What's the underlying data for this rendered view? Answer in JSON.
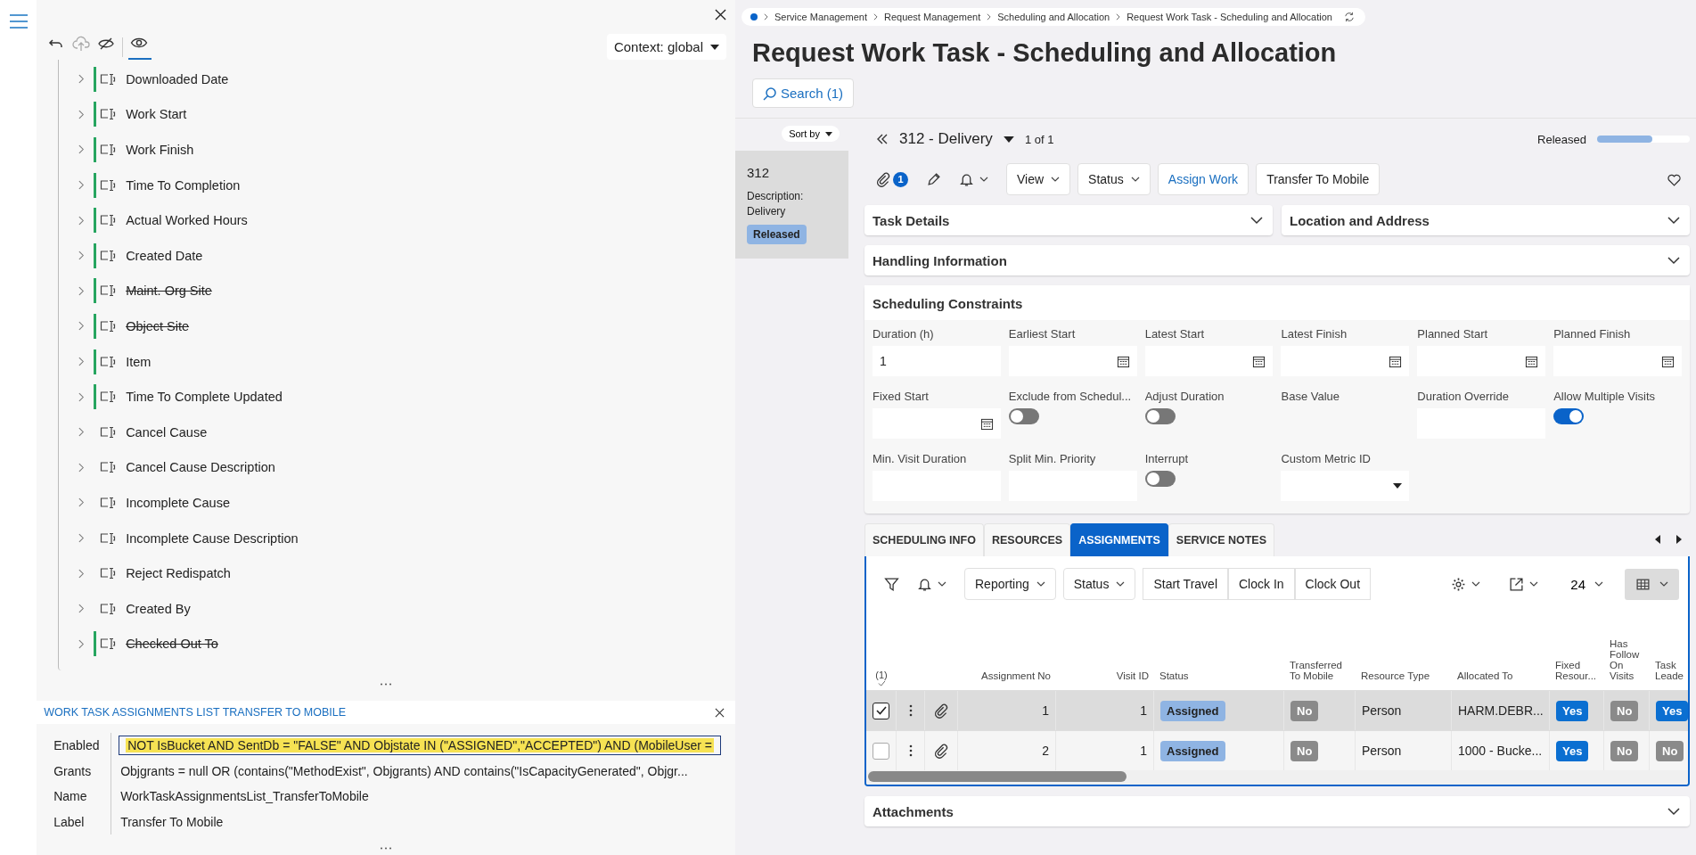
{
  "designer": {
    "context": "Context: global",
    "toolbar": [
      {
        "kind": "undo",
        "disabled": false,
        "selected": false
      },
      {
        "kind": "upload",
        "disabled": true,
        "selected": false
      },
      {
        "kind": "eye-off",
        "disabled": false,
        "selected": false
      },
      {
        "kind": "eye",
        "disabled": false,
        "selected": true
      }
    ],
    "tree": [
      {
        "label": "Downloaded Date",
        "configured": true,
        "struck": false
      },
      {
        "label": "Work Start",
        "configured": true,
        "struck": false
      },
      {
        "label": "Work Finish",
        "configured": true,
        "struck": false
      },
      {
        "label": "Time To Completion",
        "configured": true,
        "struck": false
      },
      {
        "label": "Actual Worked Hours",
        "configured": true,
        "struck": false
      },
      {
        "label": "Created Date",
        "configured": true,
        "struck": false
      },
      {
        "label": "Maint. Org Site",
        "configured": true,
        "struck": true
      },
      {
        "label": "Object Site",
        "configured": true,
        "struck": true
      },
      {
        "label": "Item",
        "configured": true,
        "struck": false
      },
      {
        "label": "Time To Complete Updated",
        "configured": true,
        "struck": false
      },
      {
        "label": "Cancel Cause",
        "configured": false,
        "struck": false
      },
      {
        "label": "Cancel Cause Description",
        "configured": false,
        "struck": false
      },
      {
        "label": "Incomplete Cause",
        "configured": false,
        "struck": false
      },
      {
        "label": "Incomplete Cause Description",
        "configured": false,
        "struck": false
      },
      {
        "label": "Reject Redispatch",
        "configured": false,
        "struck": false
      },
      {
        "label": "Created By",
        "configured": false,
        "struck": false
      },
      {
        "label": "Checked Out To",
        "configured": true,
        "struck": true
      }
    ],
    "properties": {
      "title": "WORK TASK ASSIGNMENTS LIST TRANSFER TO MOBILE",
      "rows": [
        {
          "label": "Enabled",
          "value": "NOT IsBucket AND SentDb = \"FALSE\" AND Objstate IN (\"ASSIGNED\",\"ACCEPTED\") AND (MobileUser =",
          "selected": true
        },
        {
          "label": "Grants",
          "value": "Objgrants = null OR (contains(\"MethodExist\", Objgrants) AND contains(\"IsCapacityGenerated\", Objgr...",
          "selected": false
        },
        {
          "label": "Name",
          "value": "WorkTaskAssignmentsList_TransferToMobile",
          "selected": false
        },
        {
          "label": "Label",
          "value": "Transfer To Mobile",
          "selected": false
        }
      ]
    }
  },
  "breadcrumb": [
    "Service Management",
    "Request Management",
    "Scheduling and Allocation",
    "Request Work Task - Scheduling and Allocation"
  ],
  "title": "Request Work Task - Scheduling and Allocation",
  "search_button": "Search (1)",
  "record_list": {
    "sort": "Sort by",
    "records": [
      {
        "id": "312",
        "description_label": "Description:",
        "description": "Delivery",
        "status": "Released",
        "selected": true
      }
    ]
  },
  "record": {
    "name": "312 - Delivery",
    "position": "1 of 1",
    "status": "Released",
    "level": 0.6,
    "attachments": "1",
    "actions": [
      {
        "label": "View",
        "kind": "menu"
      },
      {
        "label": "Status",
        "kind": "menu"
      },
      {
        "label": "Assign Work",
        "kind": "link"
      },
      {
        "label": "Transfer To Mobile",
        "kind": "plain"
      }
    ]
  },
  "sections": [
    {
      "title": "Task Details",
      "expanded": false
    },
    {
      "title": "Location and Address",
      "expanded": false
    }
  ],
  "handling": {
    "title": "Handling Information",
    "expanded": false
  },
  "constraints": {
    "title": "Scheduling Constraints",
    "fields": [
      {
        "label": "Duration (h)",
        "kind": "text",
        "value": "1"
      },
      {
        "label": "Earliest Start",
        "kind": "date"
      },
      {
        "label": "Latest Start",
        "kind": "date"
      },
      {
        "label": "Latest Finish",
        "kind": "date"
      },
      {
        "label": "Planned Start",
        "kind": "date"
      },
      {
        "label": "Planned Finish",
        "kind": "date"
      },
      {
        "label": "Fixed Start",
        "kind": "date"
      },
      {
        "label": "Exclude from Schedul...",
        "kind": "toggle",
        "on": false
      },
      {
        "label": "Adjust Duration",
        "kind": "toggle",
        "on": false
      },
      {
        "label": "Base Value",
        "kind": "label"
      },
      {
        "label": "Duration Override",
        "kind": "text"
      },
      {
        "label": "Allow Multiple Visits",
        "kind": "toggle",
        "on": true
      },
      {
        "label": "Min. Visit Duration",
        "kind": "text"
      },
      {
        "label": "Split Min. Priority",
        "kind": "text"
      },
      {
        "label": "Interrupt",
        "kind": "toggle",
        "on": false
      },
      {
        "label": "Custom Metric ID",
        "kind": "select"
      }
    ]
  },
  "tabs": [
    {
      "label": "SCHEDULING INFO",
      "selected": false
    },
    {
      "label": "RESOURCES",
      "selected": false
    },
    {
      "label": "ASSIGNMENTS",
      "selected": true
    },
    {
      "label": "SERVICE NOTES",
      "selected": false
    }
  ],
  "assignments": {
    "toolbar": [
      {
        "label": "Reporting",
        "kind": "menu"
      },
      {
        "label": "Status",
        "kind": "menu"
      },
      {
        "label": "Start Travel",
        "kind": "group"
      },
      {
        "label": "Clock In",
        "kind": "group"
      },
      {
        "label": "Clock Out",
        "kind": "group"
      }
    ],
    "page_size": "24",
    "selected_count": "(1)",
    "columns": [
      {
        "label": "Assignment No",
        "kind": "num"
      },
      {
        "label": "Visit ID",
        "kind": "num"
      },
      {
        "label": "Status",
        "kind": "status"
      },
      {
        "label": "Transferred To Mobile",
        "kind": "flag"
      },
      {
        "label": "Resource Type",
        "kind": "text"
      },
      {
        "label": "Allocated To",
        "kind": "text"
      },
      {
        "label": "Fixed Resour...",
        "kind": "flag"
      },
      {
        "label": "Has Follow On Visits",
        "kind": "flag"
      },
      {
        "label": "Task Leade",
        "kind": "flag"
      }
    ],
    "rows": [
      {
        "selected": true,
        "cells": [
          {
            "text": "1"
          },
          {
            "text": "1"
          },
          {
            "text": "Assigned"
          },
          {
            "text": "No",
            "on": false
          },
          {
            "text": "Person"
          },
          {
            "text": "HARM.DEBR..."
          },
          {
            "text": "Yes",
            "on": true
          },
          {
            "text": "No",
            "on": false
          },
          {
            "text": "Yes",
            "on": true
          }
        ]
      },
      {
        "selected": false,
        "cells": [
          {
            "text": "2"
          },
          {
            "text": "1"
          },
          {
            "text": "Assigned"
          },
          {
            "text": "No",
            "on": false
          },
          {
            "text": "Person"
          },
          {
            "text": "1000 - Bucke..."
          },
          {
            "text": "Yes",
            "on": true
          },
          {
            "text": "No",
            "on": false
          },
          {
            "text": "No",
            "on": false
          }
        ]
      }
    ]
  },
  "attachments": {
    "title": "Attachments",
    "expanded": false
  }
}
